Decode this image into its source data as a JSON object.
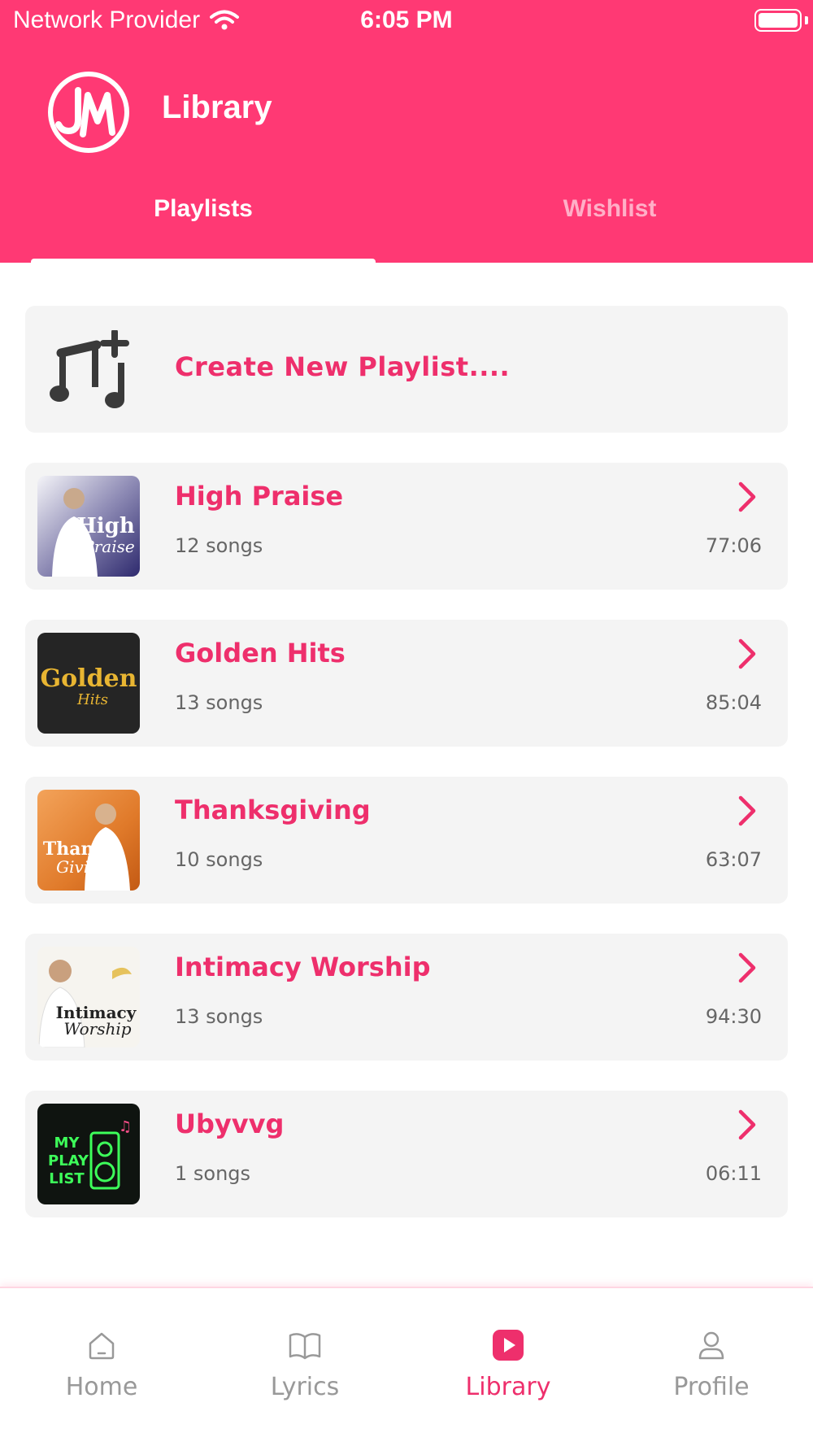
{
  "status_bar": {
    "carrier": "Network Provider",
    "time": "6:05 PM"
  },
  "header": {
    "title": "Library",
    "logo_text": "JM"
  },
  "tabs": [
    {
      "label": "Playlists",
      "active": true
    },
    {
      "label": "Wishlist",
      "active": false
    }
  ],
  "create_playlist": {
    "label": "Create New Playlist....",
    "icon": "music-plus-icon"
  },
  "playlists": [
    {
      "title": "High Praise",
      "count": "12 songs",
      "duration": "77:06",
      "cover_text": "High Praise"
    },
    {
      "title": "Golden Hits",
      "count": "13 songs",
      "duration": "85:04",
      "cover_text": "Golden Hits"
    },
    {
      "title": "Thanksgiving",
      "count": "10 songs",
      "duration": "63:07",
      "cover_text": "Thanks Giving"
    },
    {
      "title": "Intimacy Worship",
      "count": "13 songs",
      "duration": "94:30",
      "cover_text": "Intimacy Worship"
    },
    {
      "title": "Ubyvvg",
      "count": "1 songs",
      "duration": "06:11",
      "cover_text": "MY PLAY LIST"
    }
  ],
  "bottom_nav": [
    {
      "label": "Home",
      "icon": "home-icon",
      "active": false
    },
    {
      "label": "Lyrics",
      "icon": "book-icon",
      "active": false
    },
    {
      "label": "Library",
      "icon": "play-icon",
      "active": true
    },
    {
      "label": "Profile",
      "icon": "user-icon",
      "active": false
    }
  ],
  "colors": {
    "brand": "#FF3974",
    "accent_text": "#EE2F6C",
    "card_bg": "#F4F4F4"
  }
}
